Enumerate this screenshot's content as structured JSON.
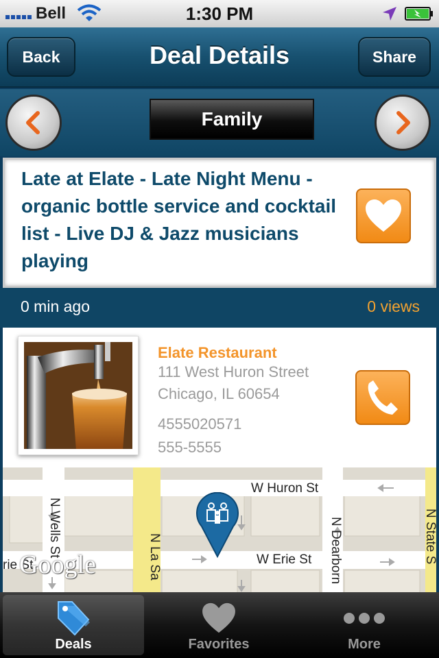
{
  "status_bar": {
    "carrier": "Bell",
    "time": "1:30 PM",
    "icons": [
      "signal-icon",
      "wifi-icon",
      "location-arrow-icon",
      "battery-charging-icon"
    ]
  },
  "nav": {
    "back_label": "Back",
    "title": "Deal Details",
    "share_label": "Share"
  },
  "category": {
    "label": "Family",
    "prev_icon": "chevron-left-icon",
    "next_icon": "chevron-right-icon"
  },
  "deal": {
    "title": "Late at Elate - Late Night Menu - organic bottle service and cocktail list - Live DJ & Jazz musicians playing",
    "favorite_icon": "heart-icon"
  },
  "meta": {
    "posted": "0 min ago",
    "views": "0 views"
  },
  "venue": {
    "name": "Elate Restaurant",
    "address_line1": "111 West Huron Street",
    "address_line2": "Chicago, IL 60654",
    "phone1": "4555020571",
    "phone2": "555-5555",
    "photo_icon": "beer-tap-photo",
    "call_icon": "phone-icon"
  },
  "map": {
    "streets": {
      "huron": "W Huron St",
      "erie": "W Erie St",
      "wells": "N Wells St",
      "lasalle": "N La Sa",
      "dearborn": "N Dearborn",
      "state": "N State S",
      "erie_left": "rie St"
    },
    "logo": "Google",
    "pin_icon": "family-pin-icon"
  },
  "tabs": [
    {
      "label": "Deals",
      "icon": "tag-icon",
      "active": true
    },
    {
      "label": "Favorites",
      "icon": "heart-icon",
      "active": false
    },
    {
      "label": "More",
      "icon": "more-dots-icon",
      "active": false
    }
  ],
  "colors": {
    "nav_blue": "#0f4564",
    "accent_orange": "#f3942a",
    "title_blue": "#0e4a6a"
  }
}
